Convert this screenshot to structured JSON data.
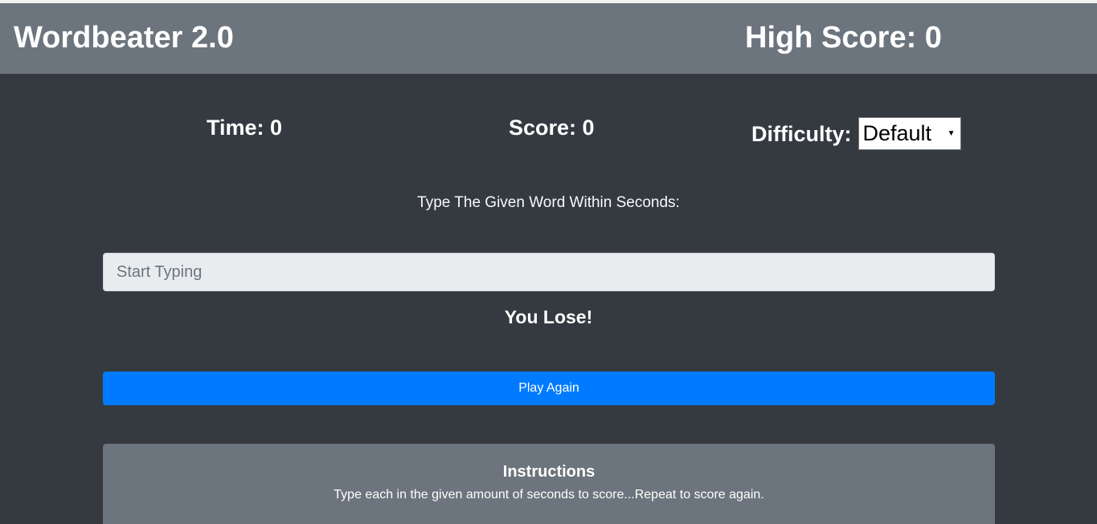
{
  "header": {
    "title": "Wordbeater 2.0",
    "high_score_label": "High Score: 0"
  },
  "stats": {
    "time_label": "Time: 0",
    "score_label": "Score: 0",
    "difficulty_label": "Difficulty:",
    "difficulty_selected": "Default"
  },
  "game": {
    "prompt": "Type The Given Word Within Seconds:",
    "input_placeholder": "Start Typing",
    "input_value": "",
    "result_message": "You Lose!",
    "play_again_label": "Play Again"
  },
  "instructions": {
    "title": "Instructions",
    "text": "Type each in the given amount of seconds to score...Repeat to score again."
  },
  "colors": {
    "background": "#343a40",
    "navbar": "#6c757d",
    "primary_button": "#007bff",
    "input_background": "#e9ecef"
  }
}
